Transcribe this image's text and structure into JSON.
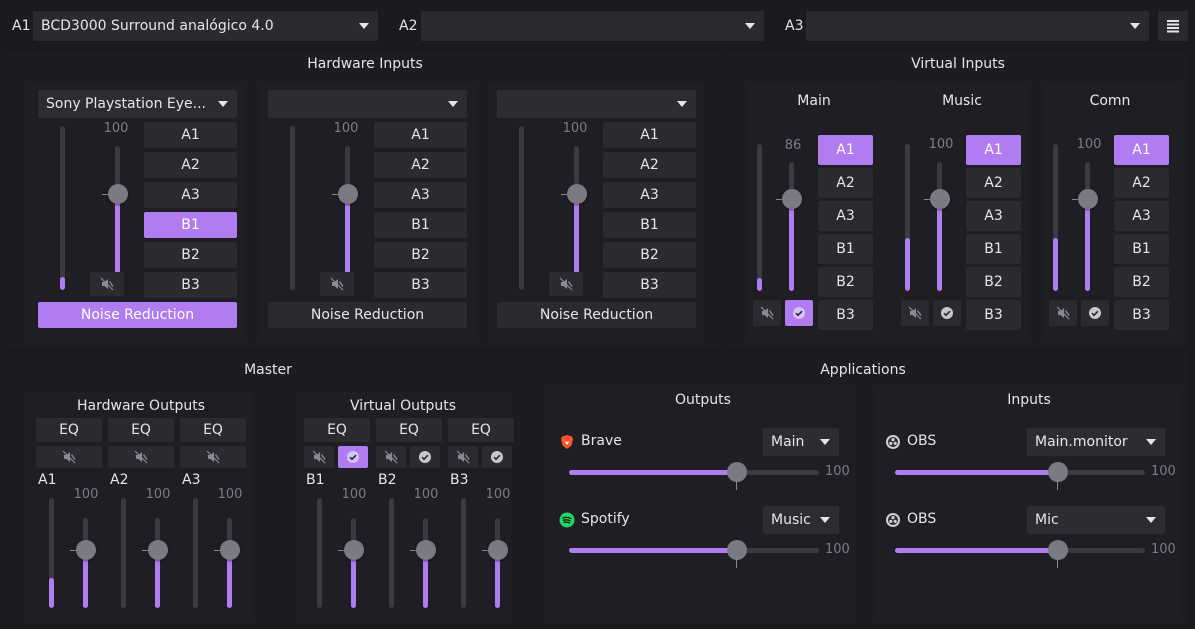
{
  "top": {
    "a1_label": "A1",
    "a1_value": "BCD3000 Surround analógico 4.0",
    "a2_label": "A2",
    "a2_value": "",
    "a3_label": "A3",
    "a3_value": ""
  },
  "hardware_inputs": {
    "title": "Hardware Inputs",
    "channels": [
      {
        "device": "Sony Playstation Eye...",
        "volume": "100",
        "buttons": [
          "A1",
          "A2",
          "A3",
          "B1",
          "B2",
          "B3"
        ],
        "active": [
          "B1"
        ],
        "noise": "Noise Reduction",
        "noise_on": true
      },
      {
        "device": "",
        "volume": "100",
        "buttons": [
          "A1",
          "A2",
          "A3",
          "B1",
          "B2",
          "B3"
        ],
        "active": [],
        "noise": "Noise Reduction",
        "noise_on": false
      },
      {
        "device": "",
        "volume": "100",
        "buttons": [
          "A1",
          "A2",
          "A3",
          "B1",
          "B2",
          "B3"
        ],
        "active": [],
        "noise": "Noise Reduction",
        "noise_on": false
      }
    ]
  },
  "virtual_inputs": {
    "title": "Virtual Inputs",
    "channels": [
      {
        "name": "Main",
        "volume": "86",
        "buttons": [
          "A1",
          "A2",
          "A3",
          "B1",
          "B2",
          "B3"
        ],
        "active": [
          "A1"
        ]
      },
      {
        "name": "Music",
        "volume": "100",
        "buttons": [
          "A1",
          "A2",
          "A3",
          "B1",
          "B2",
          "B3"
        ],
        "active": [
          "A1"
        ]
      },
      {
        "name": "Comn",
        "volume": "100",
        "buttons": [
          "A1",
          "A2",
          "A3",
          "B1",
          "B2",
          "B3"
        ],
        "active": [
          "A1"
        ]
      }
    ]
  },
  "master": {
    "title": "Master",
    "hardware_outputs": {
      "title": "Hardware Outputs",
      "eq_label": "EQ",
      "channels": [
        {
          "name": "A1",
          "volume": "100"
        },
        {
          "name": "A2",
          "volume": "100"
        },
        {
          "name": "A3",
          "volume": "100"
        }
      ]
    },
    "virtual_outputs": {
      "title": "Virtual Outputs",
      "eq_label": "EQ",
      "channels": [
        {
          "name": "B1",
          "volume": "100"
        },
        {
          "name": "B2",
          "volume": "100"
        },
        {
          "name": "B3",
          "volume": "100"
        }
      ]
    }
  },
  "applications": {
    "title": "Applications",
    "outputs": {
      "title": "Outputs",
      "items": [
        {
          "app": "Brave",
          "target": "Main",
          "volume": "100",
          "level": 0.67
        },
        {
          "app": "Spotify",
          "target": "Music",
          "volume": "100",
          "level": 0.67
        }
      ]
    },
    "inputs": {
      "title": "Inputs",
      "items": [
        {
          "app": "OBS",
          "target": "Main.monitor",
          "volume": "100",
          "level": 0.65
        },
        {
          "app": "OBS",
          "target": "Mic",
          "volume": "100",
          "level": 0.65
        }
      ]
    }
  },
  "colors": {
    "accent": "#b07cf0",
    "background": "#1a1a1f",
    "button": "#2a2a30"
  },
  "icons": {
    "mute": "speaker-muted-icon",
    "check": "check-circle-icon",
    "menu": "hamburger-menu-icon",
    "brave": "brave-lion-icon",
    "spotify": "spotify-icon",
    "obs": "obs-icon"
  }
}
